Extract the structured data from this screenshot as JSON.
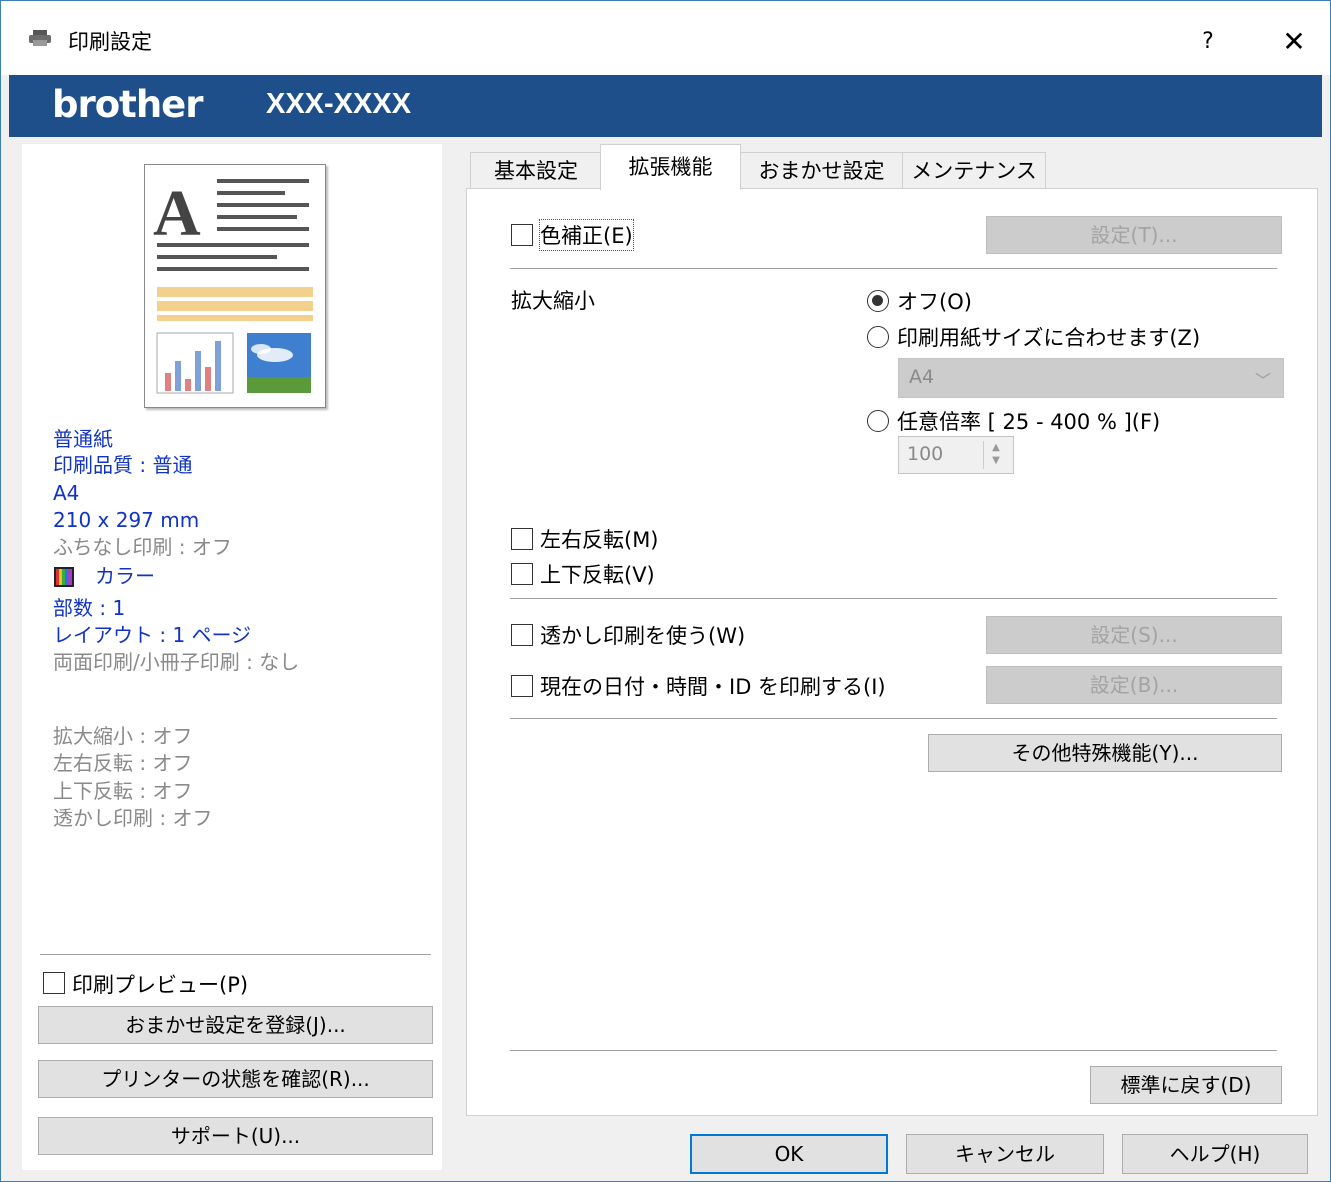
{
  "window": {
    "title": "印刷設定",
    "help_label": "?",
    "close_label": "✕",
    "brand": "brother",
    "model": "XXX-XXXX"
  },
  "summary": {
    "paper": "普通紙",
    "quality": "印刷品質 : 普通",
    "size": "A4",
    "dimensions": "210 x 297 mm",
    "borderless": "ふちなし印刷 : オフ",
    "color": "カラー",
    "copies": "部数 : 1",
    "layout": "レイアウト : 1 ページ",
    "duplex": "両面印刷/小冊子印刷 : なし",
    "scaling": "拡大縮小 : オフ",
    "mirror": "左右反転 : オフ",
    "reverse": "上下反転 : オフ",
    "watermark": "透かし印刷 : オフ"
  },
  "left_actions": {
    "print_preview": "印刷プレビュー(P)",
    "register_preset": "おまかせ設定を登録(J)...",
    "check_status": "プリンターの状態を確認(R)...",
    "support": "サポート(U)..."
  },
  "tabs": [
    {
      "label": "基本設定",
      "active": false
    },
    {
      "label": "拡張機能",
      "active": true
    },
    {
      "label": "おまかせ設定",
      "active": false
    },
    {
      "label": "メンテナンス",
      "active": false
    }
  ],
  "advanced": {
    "color_correction": {
      "label": "色補正(E)",
      "checked": false,
      "settings_label": "設定(T)..."
    },
    "scaling": {
      "label": "拡大縮小",
      "options": [
        {
          "label": "オフ(O)",
          "selected": true
        },
        {
          "label": "印刷用紙サイズに合わせます(Z)",
          "selected": false
        },
        {
          "label": "任意倍率 [ 25 - 400 % ](F)",
          "selected": false
        }
      ],
      "paper_select": "A4",
      "ratio_value": "100"
    },
    "mirror": {
      "label": "左右反転(M)",
      "checked": false
    },
    "reverse": {
      "label": "上下反転(V)",
      "checked": false
    },
    "watermark": {
      "label": "透かし印刷を使う(W)",
      "checked": false,
      "settings_label": "設定(S)..."
    },
    "header_footer": {
      "label": "現在の日付・時間・ID を印刷する(I)",
      "checked": false,
      "settings_label": "設定(B)..."
    },
    "other_features": "その他特殊機能(Y)...",
    "reset_default": "標準に戻す(D)"
  },
  "footer": {
    "ok": "OK",
    "cancel": "キャンセル",
    "help": "ヘルプ(H)"
  },
  "colors": {
    "banner": "#1f4f8a",
    "summary_text": "#1133c4",
    "disabled_text": "#8a8a8a",
    "ok_border": "#0078d7"
  }
}
